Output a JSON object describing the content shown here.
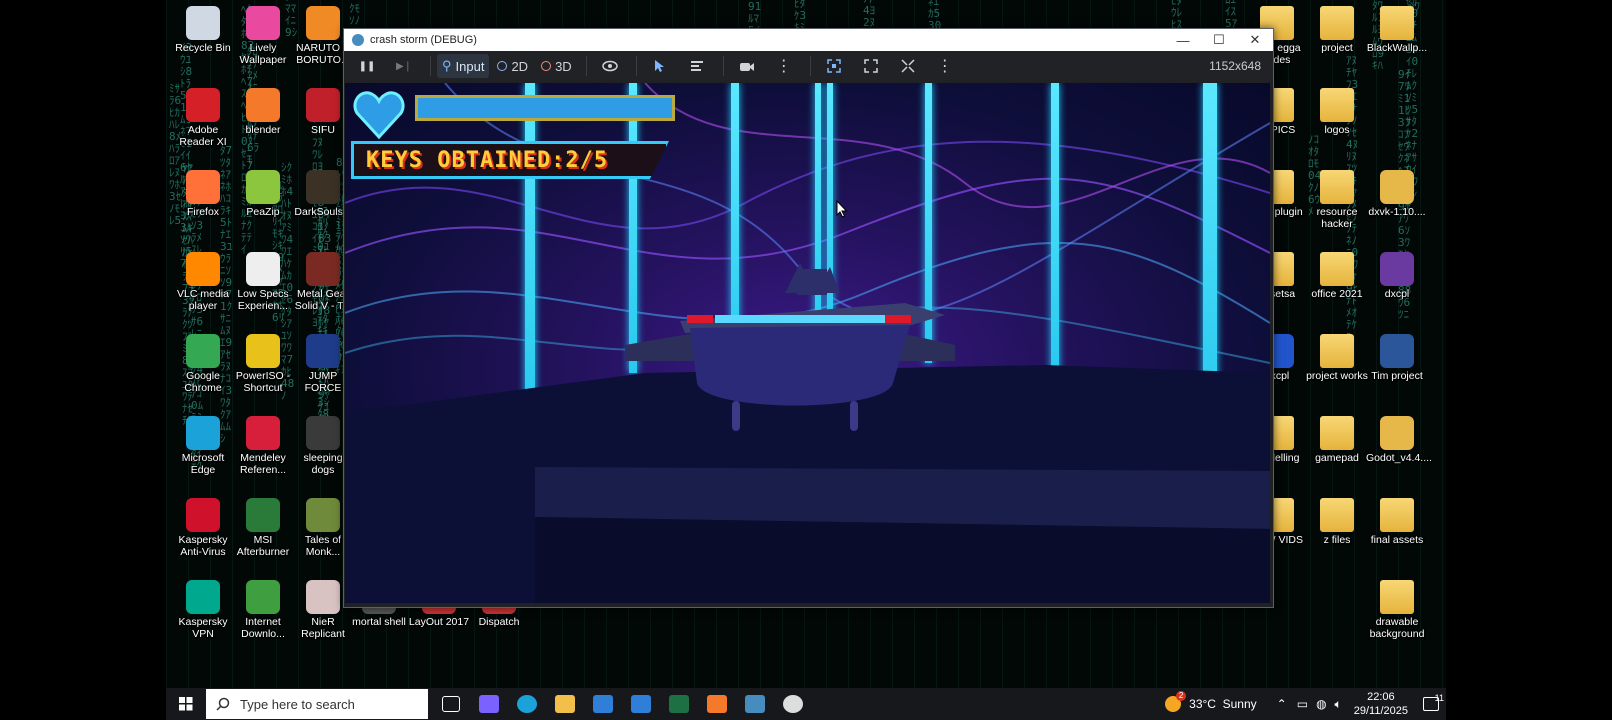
{
  "desktop": {
    "icons_left": [
      {
        "label": "Recycle Bin",
        "icon": "recycle-bin-icon",
        "color": "#cfd8e3"
      },
      {
        "label": "Lively Wallpaper",
        "icon": "lively-icon",
        "color": "#e94aa0"
      },
      {
        "label": "NARUTO X BORUTO...",
        "icon": "naruto-icon",
        "color": "#f08a24"
      },
      {
        "label": "Adobe Reader XI",
        "icon": "adobe-reader-icon",
        "color": "#d62028"
      },
      {
        "label": "blender",
        "icon": "blender-icon",
        "color": "#f5792a"
      },
      {
        "label": "SIFU",
        "icon": "sifu-icon",
        "color": "#c0202a"
      },
      {
        "label": "Firefox",
        "icon": "firefox-icon",
        "color": "#ff7139"
      },
      {
        "label": "PeaZip",
        "icon": "peazip-icon",
        "color": "#8cc63f"
      },
      {
        "label": "DarkSouls II",
        "icon": "darksouls-icon",
        "color": "#3b3125"
      },
      {
        "label": "VLC media player",
        "icon": "vlc-icon",
        "color": "#ff8800"
      },
      {
        "label": "Low Specs Experien...",
        "icon": "lse-icon",
        "color": "#eeeeee"
      },
      {
        "label": "Metal Gear Solid V - T...",
        "icon": "mgsv-icon",
        "color": "#7a2a22"
      },
      {
        "label": "Google Chrome",
        "icon": "chrome-icon",
        "color": "#34a853"
      },
      {
        "label": "PowerISO - Shortcut",
        "icon": "poweriso-icon",
        "color": "#e8c21b"
      },
      {
        "label": "JUMP FORCE",
        "icon": "jump-force-icon",
        "color": "#1f3c8a"
      },
      {
        "label": "Microsoft Edge",
        "icon": "edge-icon",
        "color": "#1aa2d9"
      },
      {
        "label": "Mendeley Referen...",
        "icon": "mendeley-icon",
        "color": "#d71f3c"
      },
      {
        "label": "sleeping dogs",
        "icon": "sleeping-dogs-icon",
        "color": "#3a3a3a"
      },
      {
        "label": "Kaspersky Anti-Virus",
        "icon": "kaspersky-icon",
        "color": "#d0112b"
      },
      {
        "label": "MSI Afterburner",
        "icon": "msi-afterburner-icon",
        "color": "#2a7a3a"
      },
      {
        "label": "Tales of Monk...",
        "icon": "tales-of-monkey-icon",
        "color": "#6f8a3a"
      },
      {
        "label": "Kaspersky VPN",
        "icon": "kaspersky-vpn-icon",
        "color": "#00a88e"
      },
      {
        "label": "Internet Downlo...",
        "icon": "idm-icon",
        "color": "#3f9e3f"
      },
      {
        "label": "NieR Replicant",
        "icon": "nier-icon",
        "color": "#d8c2c2"
      }
    ],
    "icons_bottom": [
      {
        "label": "mortal shell",
        "icon": "mortal-shell-icon",
        "color": "#555555"
      },
      {
        "label": "LayOut 2017",
        "icon": "layout-icon",
        "color": "#c83232"
      },
      {
        "label": "Dispatch",
        "icon": "dispatch-icon",
        "color": "#c83232"
      }
    ],
    "icons_right": [
      {
        "label": "roup egga slides",
        "icon": "folder-icon",
        "color": "#f0c34a"
      },
      {
        "label": "project",
        "icon": "folder-icon",
        "color": "#f0c34a"
      },
      {
        "label": "BlackWallp...",
        "icon": "folder-icon",
        "color": "#f0c34a"
      },
      {
        "label": "IT PICS",
        "icon": "folder-icon",
        "color": "#f0c34a"
      },
      {
        "label": "logos",
        "icon": "folder-icon",
        "color": "#f0c34a"
      },
      {
        "label": "",
        "icon": "blank-icon",
        "color": ""
      },
      {
        "label": "odot plugin",
        "icon": "folder-icon",
        "color": "#f0c34a"
      },
      {
        "label": "resource hacker",
        "icon": "folder-icon",
        "color": "#f0c34a"
      },
      {
        "label": "dxvk-1.10....",
        "icon": "archive-box-icon",
        "color": "#e6b84a"
      },
      {
        "label": "assetsa",
        "icon": "folder-icon",
        "color": "#f0c34a"
      },
      {
        "label": "office 2021",
        "icon": "folder-icon",
        "color": "#f0c34a"
      },
      {
        "label": "dxcpl",
        "icon": "winrar-icon",
        "color": "#6a3aa0"
      },
      {
        "label": "dxcpl",
        "icon": "dxcpl-icon",
        "color": "#2255cc"
      },
      {
        "label": "project works",
        "icon": "folder-icon",
        "color": "#f0c34a"
      },
      {
        "label": "Tim project",
        "icon": "word-doc-icon",
        "color": "#2b579a"
      },
      {
        "label": "modelling",
        "icon": "folder-icon",
        "color": "#f0c34a"
      },
      {
        "label": "gamepad",
        "icon": "folder-icon",
        "color": "#f0c34a"
      },
      {
        "label": "Godot_v4.4....",
        "icon": "archive-box-icon",
        "color": "#e6b84a"
      },
      {
        "label": "NEW VIDS",
        "icon": "folder-icon",
        "color": "#f0c34a"
      },
      {
        "label": "z files",
        "icon": "folder-icon",
        "color": "#f0c34a"
      },
      {
        "label": "final assets",
        "icon": "folder-icon",
        "color": "#f0c34a"
      },
      {
        "label": "",
        "icon": "blank-icon",
        "color": ""
      },
      {
        "label": "",
        "icon": "blank-icon",
        "color": ""
      },
      {
        "label": "drawable background",
        "icon": "folder-icon",
        "color": "#f0c34a"
      }
    ]
  },
  "window": {
    "title": "crash storm (DEBUG)",
    "minimize": "—",
    "maximize": "☐",
    "close": "✕",
    "toolbar": {
      "pause": "❚❚",
      "next_frame": "▶❘",
      "input": "Input",
      "mode_2d": "2D",
      "mode_3d": "3D",
      "resolution": "1152x648"
    }
  },
  "game": {
    "keys_text": "KEYS OBTAINED:2/5",
    "health": 1.0,
    "colors": {
      "beam": "#5be8ff",
      "hud_bar": "#2f9de5",
      "hud_border": "#b9a93e",
      "keys_text": "#ffcc3a"
    }
  },
  "taskbar": {
    "search_placeholder": "Type here to search",
    "apps": [
      "task-view-icon",
      "copilot-icon",
      "edge-icon",
      "file-explorer-icon",
      "mail-icon",
      "store-icon",
      "excel-icon",
      "blender-icon",
      "godot-icon",
      "obs-icon"
    ],
    "weather": "33°C  Sunny",
    "weather_badge": "2",
    "time": "22:06",
    "date": "29/11/2025",
    "notifications": "11"
  }
}
